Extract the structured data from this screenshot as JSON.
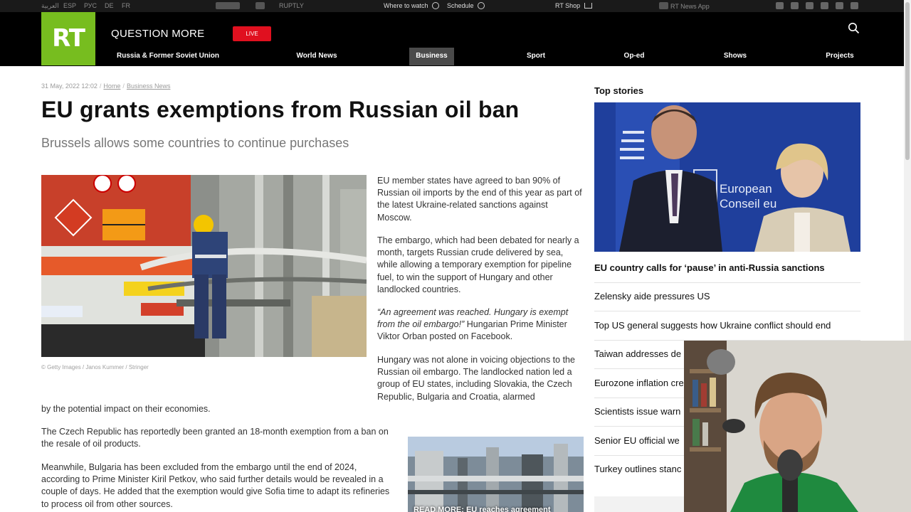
{
  "utility_bar": {
    "languages": [
      "العربية",
      "ESP",
      "РУС",
      "DE",
      "FR"
    ],
    "partners": [
      "ИНОTV",
      "RUPTLY"
    ],
    "where_to_watch": "Where to watch",
    "schedule": "Schedule",
    "rt_shop": "RT Shop",
    "news_app": "RT News App"
  },
  "header": {
    "logo": "RT",
    "tagline": "QUESTION MORE",
    "live_label": "LIVE",
    "nav": [
      {
        "label": "Russia & Former Soviet Union"
      },
      {
        "label": "World News"
      },
      {
        "label": "Business"
      },
      {
        "label": "Sport"
      },
      {
        "label": "Op-ed"
      },
      {
        "label": "Shows"
      },
      {
        "label": "Projects"
      }
    ]
  },
  "article": {
    "date": "31 May, 2022 12:02",
    "breadcrumbs": [
      "Home",
      "Business News"
    ],
    "headline": "EU grants exemptions from Russian oil ban",
    "subheadline": "Brussels allows some countries to continue purchases",
    "photo_caption": "© Getty Images / Janos Kummer / Stringer",
    "paragraphs": [
      "EU member states have agreed to ban 90% of Russian oil imports by the end of this year as part of the latest Ukraine-related sanctions against Moscow.",
      "The embargo, which had been debated for nearly a month, targets Russian crude delivered by sea, while allowing a temporary exemption for pipeline fuel, to win the support of Hungary and other landlocked countries.",
      "Hungary was not alone in voicing objections to the Russian oil embargo. The landlocked nation led a group of EU states, including Slovakia, the Czech Republic, Bulgaria and Croatia, alarmed",
      "by the potential impact on their economies.",
      "The Czech Republic has reportedly been granted an 18-month exemption from a ban on the resale of oil products.",
      "Meanwhile, Bulgaria has been excluded from the embargo until the end of 2024, according to Prime Minister Kiril Petkov, who said further details would be revealed in a couple of days. He added that the exemption would give Sofia time to adapt its refineries to process oil from other sources."
    ],
    "quote": "“An agreement was reached. Hungary is exempt from the oil embargo!”",
    "quote_attribution": " Hungarian Prime Minister Viktor Orban posted on Facebook.",
    "read_more": "READ MORE: EU reaches agreement"
  },
  "sidebar": {
    "title": "Top stories",
    "stories": [
      "EU country calls for ‘pause’ in anti-Russia sanctions",
      "Zelensky aide pressures US",
      "Top US general suggests how Ukraine conflict should end",
      "Taiwan addresses de",
      "Eurozone inflation cre",
      "Scientists issue warn",
      "Senior EU official we",
      "Turkey outlines stanc"
    ],
    "photo_sign": [
      "European",
      "Conseil eu"
    ]
  },
  "colors": {
    "brand_green": "#77bd1f",
    "live_red": "#e0101f",
    "header_bg": "#000000",
    "active_nav": "#4a4a4a"
  }
}
